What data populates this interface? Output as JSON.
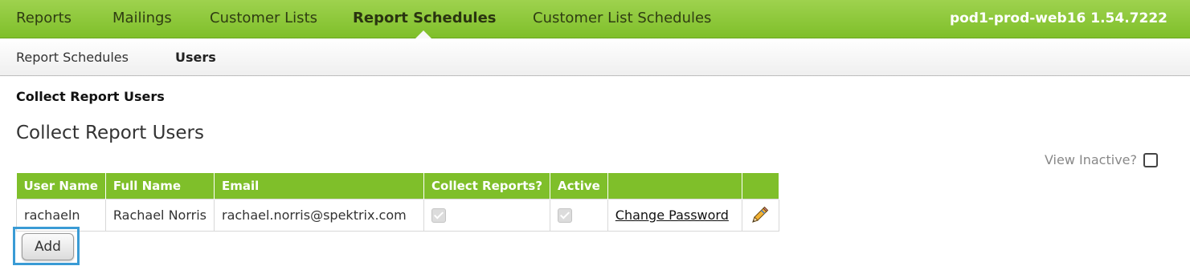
{
  "top_nav": {
    "tabs": [
      {
        "label": "Reports"
      },
      {
        "label": "Mailings"
      },
      {
        "label": "Customer Lists"
      },
      {
        "label": "Report Schedules",
        "active": true
      },
      {
        "label": "Customer List Schedules"
      }
    ],
    "server": "pod1-prod-web16 1.54.7222"
  },
  "sub_nav": {
    "tabs": [
      {
        "label": "Report Schedules"
      },
      {
        "label": "Users",
        "active": true
      }
    ]
  },
  "breadcrumb": "Collect Report Users",
  "page_title": "Collect Report Users",
  "view_inactive_label": "View Inactive?",
  "table": {
    "headers": [
      "User Name",
      "Full Name",
      "Email",
      "Collect Reports?",
      "Active",
      "",
      ""
    ],
    "rows": [
      {
        "user_name": "rachaeln",
        "full_name": "Rachael Norris",
        "email": "rachael.norris@spektrix.com",
        "collect_reports": true,
        "active": true,
        "change_password": "Change Password",
        "edit_icon": "pencil-icon"
      }
    ]
  },
  "add_button": "Add",
  "colors": {
    "nav_green": "#7fbf2a",
    "highlight_blue": "#3a9bd5"
  }
}
